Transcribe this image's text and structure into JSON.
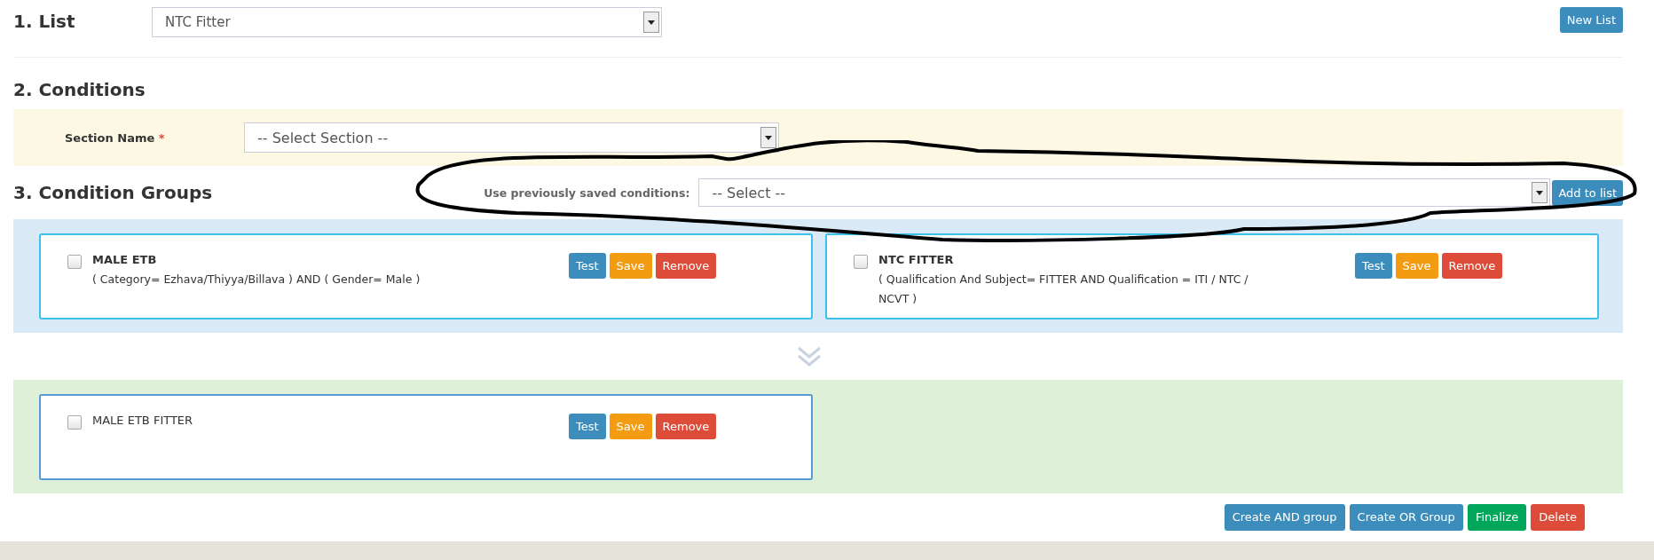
{
  "list": {
    "heading": "1. List",
    "value": "NTC Fitter",
    "new_button": "New List"
  },
  "conditions": {
    "heading": "2. Conditions",
    "section_label": "Section Name",
    "required_mark": "*",
    "section_value": "-- Select Section --"
  },
  "condition_groups": {
    "heading": "3. Condition Groups",
    "saved_label": "Use previously saved conditions:",
    "saved_value": "-- Select --",
    "add_button": "Add to list"
  },
  "bands": [
    {
      "kind": "and",
      "cards": [
        {
          "title": "MALE ETB",
          "title_bold": true,
          "checked": false,
          "expression": "( Category= Ezhava/Thiyya/Billava ) AND ( Gender= Male )",
          "buttons": [
            {
              "label": "Test",
              "kind": "primary"
            },
            {
              "label": "Save",
              "kind": "warning"
            },
            {
              "label": "Remove",
              "kind": "danger"
            }
          ]
        },
        {
          "title": "NTC FITTER",
          "title_bold": true,
          "checked": false,
          "expression": "( Qualification And Subject= FITTER AND Qualification = ITI / NTC / NCVT )",
          "buttons": [
            {
              "label": "Test",
              "kind": "primary"
            },
            {
              "label": "Save",
              "kind": "warning"
            },
            {
              "label": "Remove",
              "kind": "danger"
            }
          ]
        }
      ]
    },
    {
      "kind": "or",
      "cards": [
        {
          "title": "MALE ETB FITTER",
          "title_bold": false,
          "checked": false,
          "buttons": [
            {
              "label": "Test",
              "kind": "primary"
            },
            {
              "label": "Save",
              "kind": "warning"
            },
            {
              "label": "Remove",
              "kind": "danger"
            }
          ]
        }
      ]
    }
  ],
  "actions": [
    {
      "label": "Create AND group",
      "kind": "primary"
    },
    {
      "label": "Create OR Group",
      "kind": "primary"
    },
    {
      "label": "Finalize",
      "kind": "success"
    },
    {
      "label": "Delete",
      "kind": "danger"
    }
  ]
}
